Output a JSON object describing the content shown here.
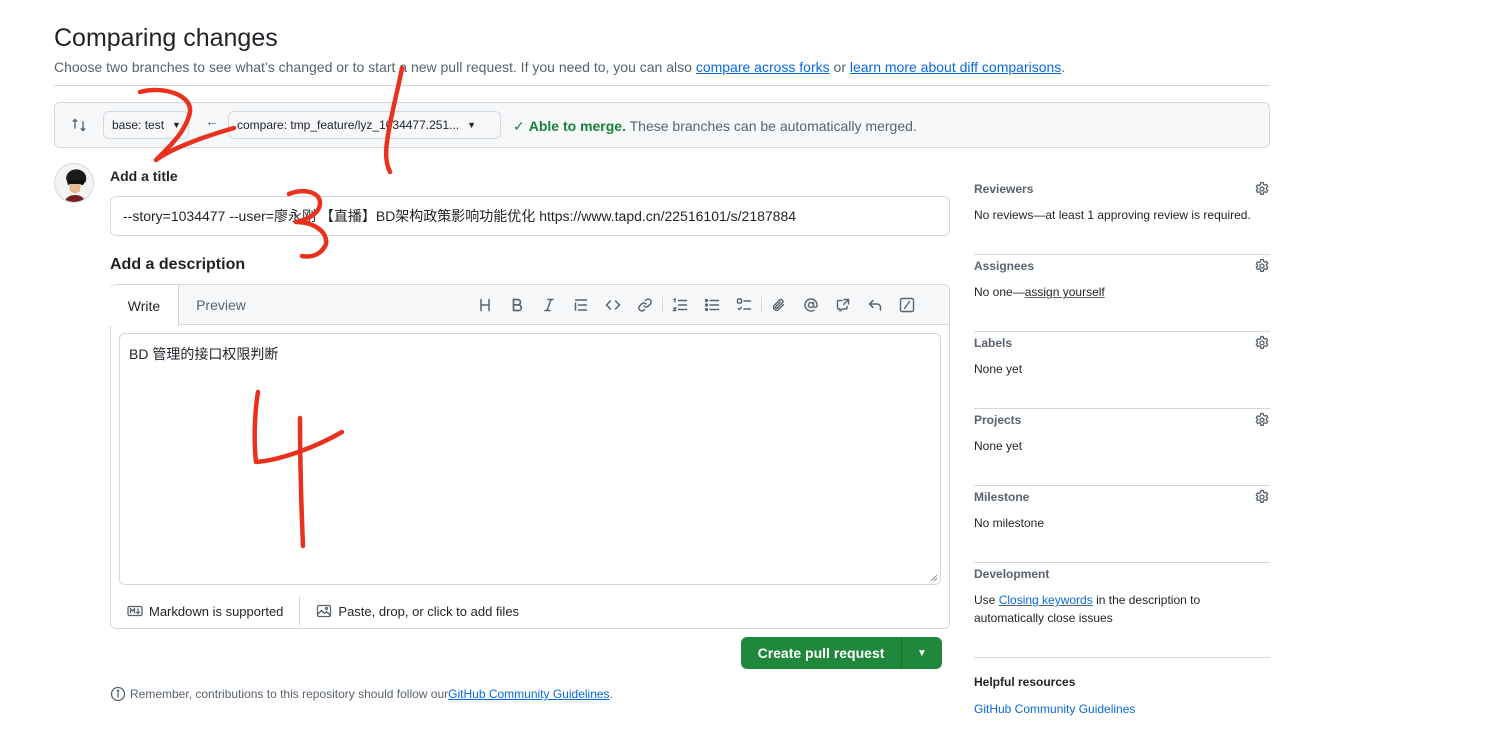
{
  "header": {
    "title": "Comparing changes",
    "subtitle_prefix": "Choose two branches to see what’s changed or to start a new pull request. If you need to, you can also ",
    "link_forks": "compare across forks",
    "subtitle_or": " or ",
    "link_learn": "learn more about diff comparisons",
    "subtitle_end": "."
  },
  "compare": {
    "base_label": "base: test",
    "compare_label": "compare: tmp_feature/lyz_1034477.251...",
    "merge_ok": "Able to merge.",
    "merge_text": " These branches can be automatically merged."
  },
  "form": {
    "title_label": "Add a title",
    "title_value": "--story=1034477 --user=廖永刚 【直播】BD架构政策影响功能优化 https://www.tapd.cn/22516101/s/2187884",
    "desc_label": "Add a description",
    "tab_write": "Write",
    "tab_preview": "Preview",
    "body_text": "BD 管理的接口权限判断",
    "markdown_note": "Markdown is supported",
    "attach_note": "Paste, drop, or click to add files",
    "create_button": "Create pull request",
    "remember_prefix": "Remember, contributions to this repository should follow our ",
    "remember_link": "GitHub Community Guidelines",
    "remember_end": "."
  },
  "sidebar": {
    "reviewers_title": "Reviewers",
    "reviewers_value": "No reviews—at least 1 approving review is required.",
    "assignees_title": "Assignees",
    "assignees_prefix": "No one—",
    "assignees_link": "assign yourself",
    "labels_title": "Labels",
    "labels_value": "None yet",
    "projects_title": "Projects",
    "projects_value": "None yet",
    "milestone_title": "Milestone",
    "milestone_value": "No milestone",
    "development_title": "Development",
    "development_prefix": "Use ",
    "development_link": "Closing keywords",
    "development_suffix": " in the description to automatically close issues",
    "help_title": "Helpful resources",
    "help_link": "GitHub Community Guidelines"
  },
  "annotations": [
    "2",
    "1",
    "3",
    "4"
  ],
  "colors": {
    "primary_button": "#1f883d",
    "link": "#0969da",
    "merge_ok": "#1a7f37",
    "annotation": "#e8321e"
  },
  "icons": [
    "compare-arrows-icon",
    "arrow-left-icon",
    "check-icon",
    "heading-icon",
    "bold-icon",
    "italic-icon",
    "quote-icon",
    "code-icon",
    "link-icon",
    "ordered-list-icon",
    "unordered-list-icon",
    "task-list-icon",
    "attach-icon",
    "mention-icon",
    "cross-reference-icon",
    "reply-icon",
    "slash-command-icon",
    "markdown-icon",
    "image-icon",
    "info-icon",
    "gear-icon"
  ]
}
